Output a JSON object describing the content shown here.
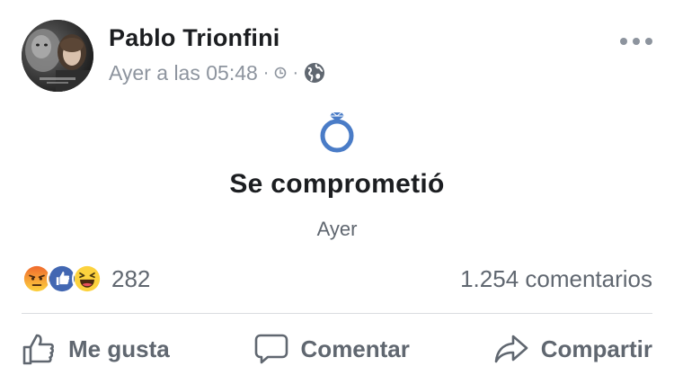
{
  "post": {
    "author_name": "Pablo Trionfini",
    "timestamp": "Ayer a las 05:48",
    "audience_icon": "globe-icon",
    "clock_icon": "clock-icon",
    "more_icon": "more-options-icon"
  },
  "life_event": {
    "icon": "engagement-ring-icon",
    "title": "Se comprometió",
    "date": "Ayer"
  },
  "reactions": {
    "types": [
      "angry",
      "like",
      "haha"
    ],
    "count": "282",
    "comments": "1.254 comentarios"
  },
  "actions": {
    "like_label": "Me gusta",
    "comment_label": "Comentar",
    "share_label": "Compartir"
  },
  "colors": {
    "like_blue": "#4267b2",
    "reaction_yellow": "#fcd23e",
    "angry_orange": "#f06a2d",
    "meta_gray": "#8d949e"
  }
}
